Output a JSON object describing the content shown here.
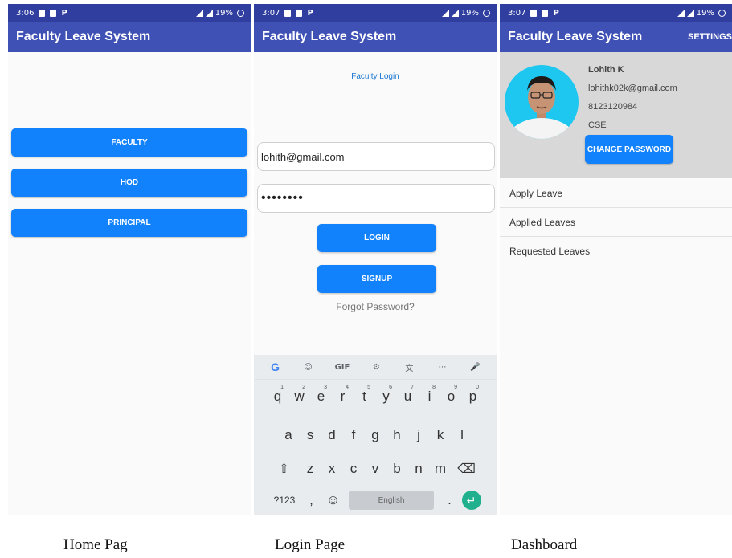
{
  "screens": [
    {
      "time": "3:06",
      "battery": "19%",
      "app_title": "Faculty Leave System",
      "buttons": [
        "FACULTY",
        "HOD",
        "PRINCIPAL"
      ]
    },
    {
      "time": "3:07",
      "battery": "19%",
      "app_title": "Faculty Leave System",
      "heading": "Faculty Login",
      "email_value": "lohith@gmail.com",
      "password_value": "••••••••",
      "login_label": "LOGIN",
      "signup_label": "SIGNUP",
      "forgot_label": "Forgot Password?",
      "keyboard": {
        "toolbar": [
          "G",
          "☺",
          "GIF",
          "⚙",
          "文",
          "⋯",
          "🎤"
        ],
        "row1": [
          "q",
          "w",
          "e",
          "r",
          "t",
          "y",
          "u",
          "i",
          "o",
          "p"
        ],
        "row1_hints": [
          "1",
          "2",
          "3",
          "4",
          "5",
          "6",
          "7",
          "8",
          "9",
          "0"
        ],
        "row2": [
          "a",
          "s",
          "d",
          "f",
          "g",
          "h",
          "j",
          "k",
          "l"
        ],
        "row3": [
          "⇧",
          "z",
          "x",
          "c",
          "v",
          "b",
          "n",
          "m",
          "⌫"
        ],
        "sym_label": "?123",
        "comma": ",",
        "emoji": "☺",
        "space_label": "English",
        "period": ".",
        "enter": "↵"
      }
    },
    {
      "time": "3:07",
      "battery": "19%",
      "app_title": "Faculty Leave System",
      "settings_label": "SETTINGS",
      "profile": {
        "name": "Lohith K",
        "email": "lohithk02k@gmail.com",
        "phone": "8123120984",
        "dept": "CSE"
      },
      "change_password_label": "CHANGE PASSWORD",
      "menu": [
        "Apply Leave",
        "Applied Leaves",
        "Requested Leaves"
      ]
    }
  ],
  "captions": [
    "Home Pag",
    "Login Page",
    "Dashboard"
  ],
  "colors": {
    "status_bar": "#303f9f",
    "app_bar": "#3f51b5",
    "button": "#1182fb",
    "avatar_bg": "#1ec7ef"
  }
}
